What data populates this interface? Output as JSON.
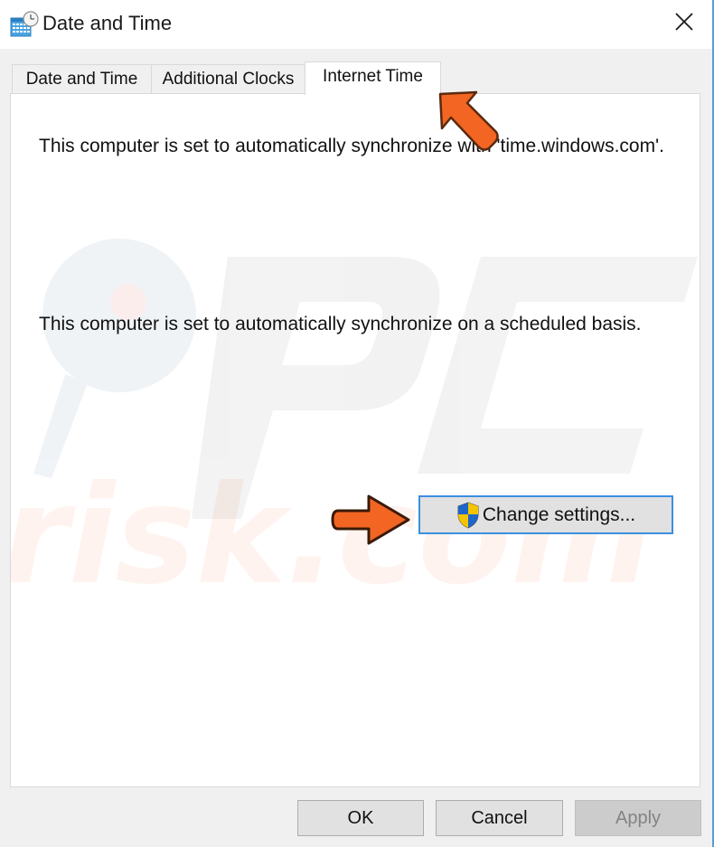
{
  "window": {
    "title": "Date and Time",
    "icon": "calendar-clock-icon",
    "close_icon": "close-icon",
    "border_color": "#5a9bd5"
  },
  "tabs": [
    {
      "label": "Date and Time",
      "selected": false
    },
    {
      "label": "Additional Clocks",
      "selected": false
    },
    {
      "label": "Internet Time",
      "selected": true
    }
  ],
  "panel": {
    "sync_server_text": "This computer is set to automatically synchronize with 'time.windows.com'.",
    "schedule_text": "This computer is set to automatically synchronize on a scheduled basis.",
    "change_settings_label": "Change settings...",
    "change_settings_icon": "uac-shield-icon"
  },
  "annotations": {
    "arrow_color": "#f26522",
    "watermark_text": "PC risk.com"
  },
  "footer": {
    "ok_label": "OK",
    "cancel_label": "Cancel",
    "apply_label": "Apply",
    "apply_enabled": false
  }
}
